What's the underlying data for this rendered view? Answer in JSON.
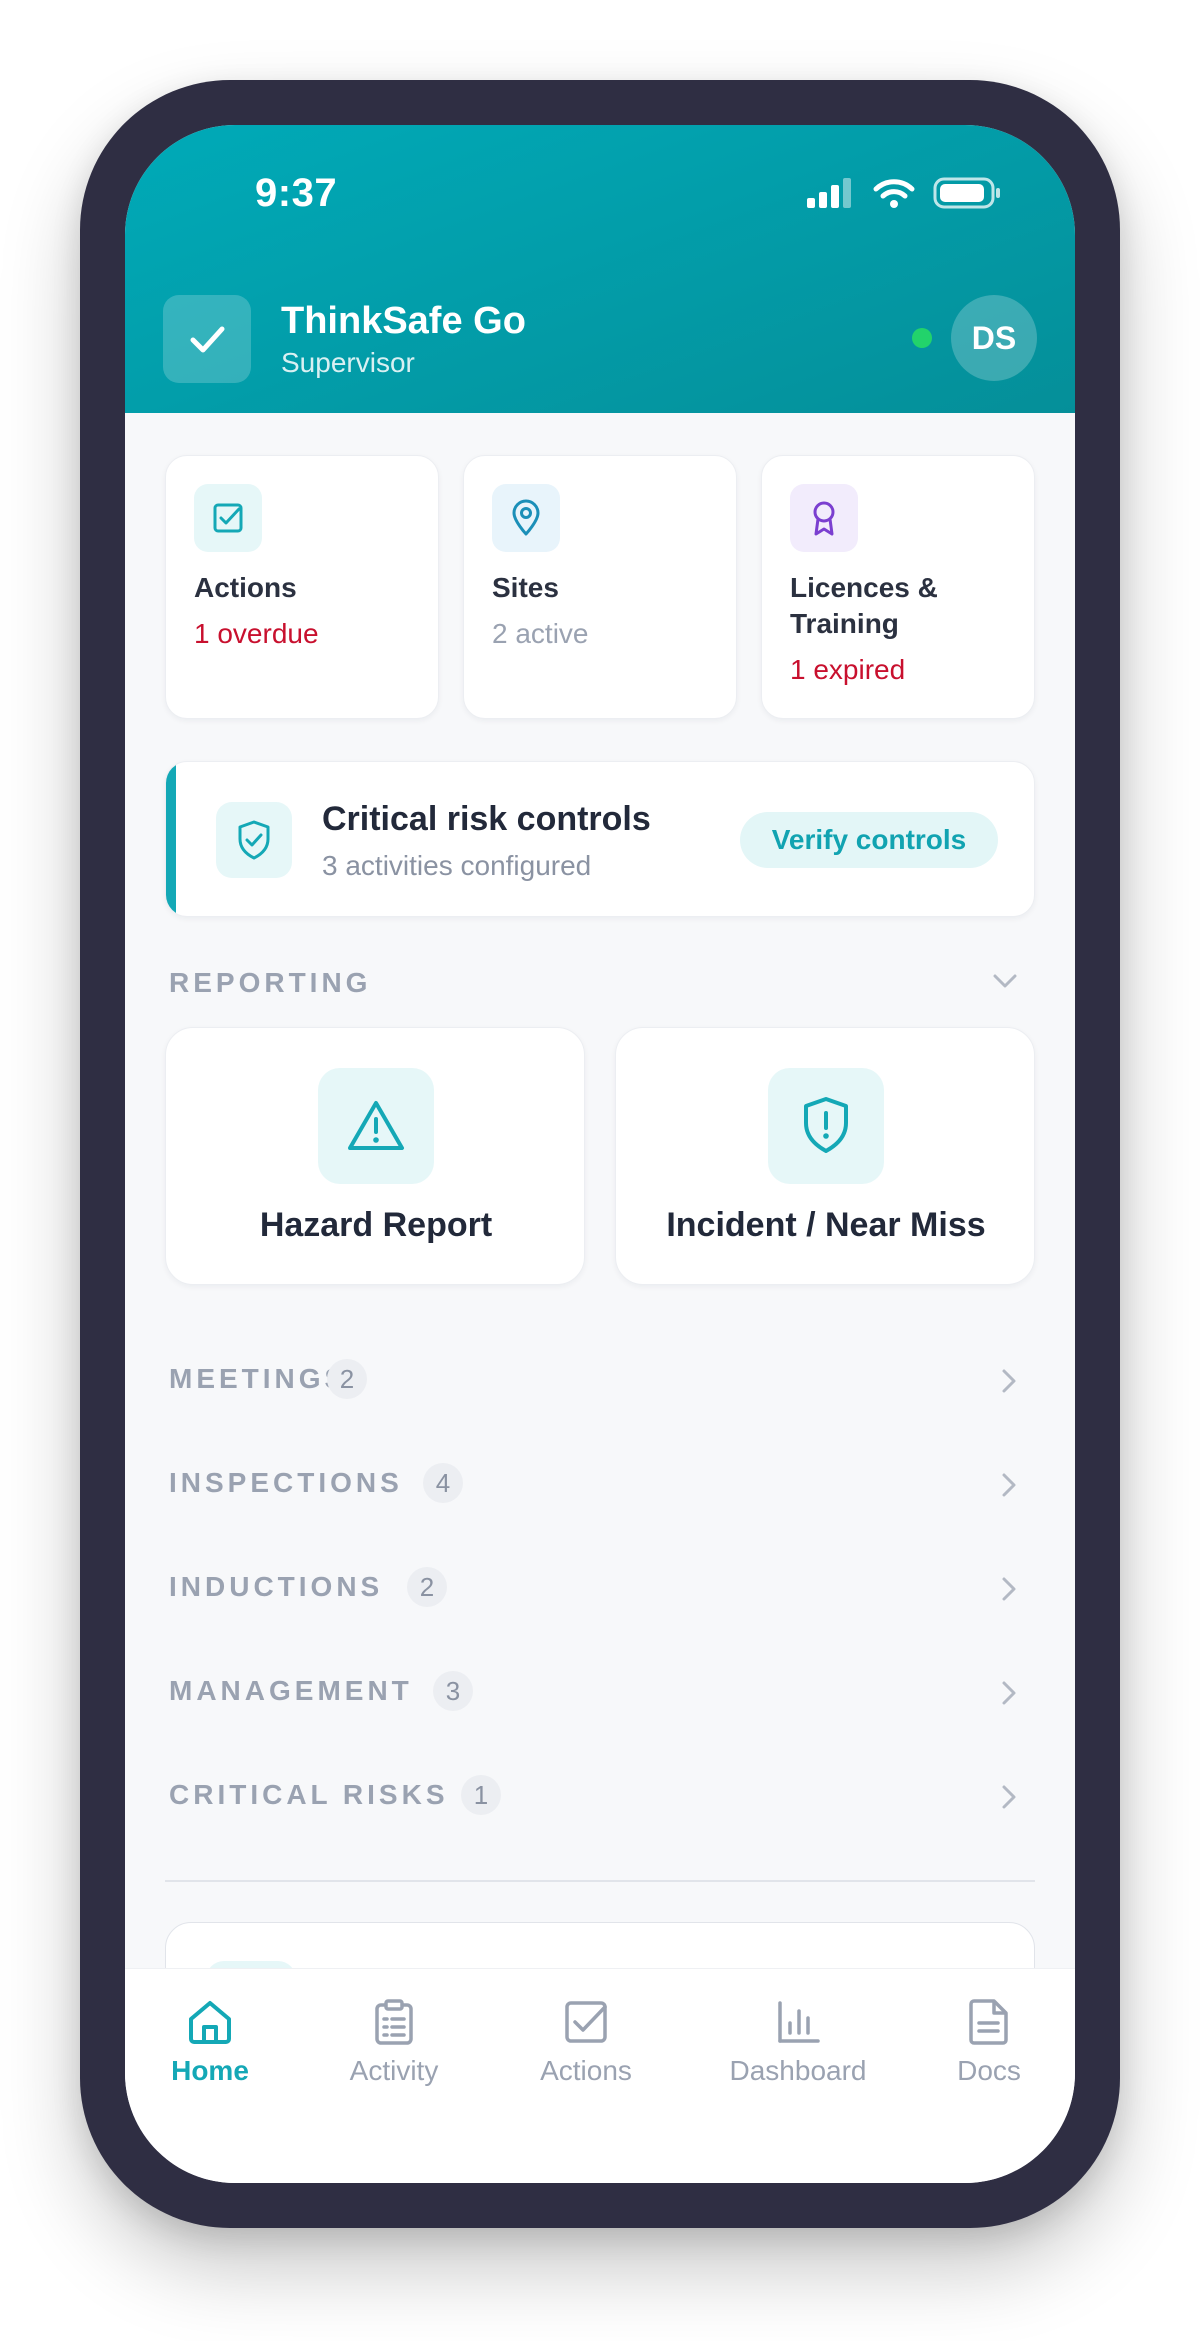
{
  "status_bar": {
    "time": "9:37"
  },
  "header": {
    "title": "ThinkSafe Go",
    "subtitle": "Supervisor",
    "avatar_initials": "DS",
    "online_color": "#22d36b"
  },
  "stats": [
    {
      "title": "Actions",
      "sub": "1 overdue",
      "sub_color": "#c8102e",
      "icon": "checkbox-icon"
    },
    {
      "title": "Sites",
      "sub": "2 active",
      "sub_color": "#9aa2b1",
      "icon": "map-pin-icon"
    },
    {
      "title": "Licences & Training",
      "sub": "1 expired",
      "sub_color": "#c8102e",
      "icon": "award-icon"
    }
  ],
  "critical_card": {
    "title": "Critical risk controls",
    "subtitle": "3 activities configured",
    "button_label": "Verify controls"
  },
  "reporting": {
    "label": "REPORTING",
    "cards": [
      {
        "label": "Hazard Report",
        "icon": "warning-triangle-icon"
      },
      {
        "label": "Incident / Near Miss",
        "icon": "shield-alert-icon"
      }
    ]
  },
  "sections": [
    {
      "label": "MEETINGS",
      "count": "2"
    },
    {
      "label": "INSPECTIONS",
      "count": "4"
    },
    {
      "label": "INDUCTIONS",
      "count": "2"
    },
    {
      "label": "MANAGEMENT",
      "count": "3"
    },
    {
      "label": "CRITICAL RISKS",
      "count": "1"
    }
  ],
  "nav": [
    {
      "label": "Home",
      "icon": "home-icon",
      "active": true
    },
    {
      "label": "Activity",
      "icon": "clipboard-icon",
      "active": false
    },
    {
      "label": "Actions",
      "icon": "checkbox-icon",
      "active": false
    },
    {
      "label": "Dashboard",
      "icon": "bar-chart-icon",
      "active": false
    },
    {
      "label": "Docs",
      "icon": "document-icon",
      "active": false
    }
  ],
  "colors": {
    "accent": "#14a8b6",
    "header_gradient_start": "#00aab8",
    "header_gradient_end": "#058f99",
    "danger": "#c8102e",
    "phone_frame": "#2f2e43"
  }
}
